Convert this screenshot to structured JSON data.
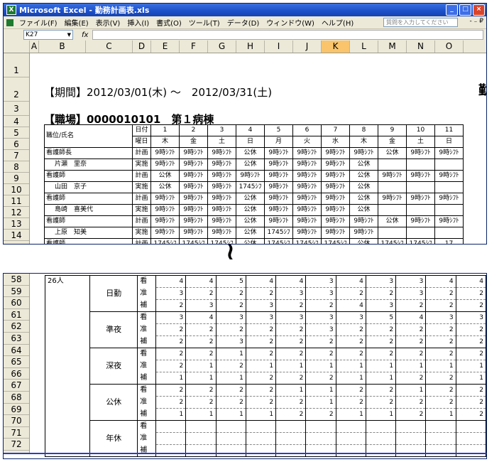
{
  "window": {
    "title": "Microsoft Excel - 勤務計画表.xls",
    "controls": [
      "_",
      "□",
      "×"
    ]
  },
  "menu": {
    "items": [
      "ファイル(F)",
      "編集(E)",
      "表示(V)",
      "挿入(I)",
      "書式(O)",
      "ツール(T)",
      "データ(D)",
      "ウィンドウ(W)",
      "ヘルプ(H)"
    ],
    "help_placeholder": "質問を入力してください",
    "right": "- ₋ ₽"
  },
  "formula": {
    "name_box": "K27",
    "fx": "fx",
    "value": ""
  },
  "columns": [
    "A",
    "B",
    "C",
    "D",
    "E",
    "F",
    "G",
    "H",
    "I",
    "J",
    "K",
    "L",
    "M",
    "N",
    "O"
  ],
  "rows_top": [
    "1",
    "2",
    "3",
    "4",
    "5",
    "6",
    "7",
    "8",
    "9",
    "10",
    "11",
    "12",
    "13",
    "14"
  ],
  "rows_bottom": [
    "58",
    "59",
    "60",
    "61",
    "62",
    "63",
    "64",
    "65",
    "66",
    "67",
    "68",
    "69",
    "70",
    "71",
    "72"
  ],
  "sheet": {
    "period": "【期間】2012/03/01(木) ～　2012/03/31(土)",
    "period_right": "勤",
    "workplace": "【職場】0000010101　第１病棟",
    "header": {
      "job_name": "職位/氏名",
      "date_label": "日付",
      "dow_label": "曜日",
      "dates": [
        "1",
        "2",
        "3",
        "4",
        "5",
        "6",
        "7",
        "8",
        "9",
        "10",
        "11"
      ],
      "dows": [
        "木",
        "金",
        "土",
        "日",
        "月",
        "火",
        "水",
        "木",
        "金",
        "土",
        "日"
      ]
    },
    "staff": [
      {
        "title": "看護師長",
        "name": "片瀬　里奈",
        "plan": [
          "9時ｼﾌﾄ",
          "9時ｼﾌﾄ",
          "9時ｼﾌﾄ",
          "公休",
          "9時ｼﾌﾄ",
          "9時ｼﾌﾄ",
          "9時ｼﾌﾄ",
          "9時ｼﾌﾄ",
          "公休",
          "9時ｼﾌﾄ",
          "9時ｼﾌﾄ"
        ],
        "actual": [
          "9時ｼﾌﾄ",
          "9時ｼﾌﾄ",
          "9時ｼﾌﾄ",
          "公休",
          "9時ｼﾌﾄ",
          "9時ｼﾌﾄ",
          "9時ｼﾌﾄ",
          "公休",
          "",
          "",
          ""
        ]
      },
      {
        "title": "看護師",
        "name": "山田　京子",
        "plan": [
          "公休",
          "9時ｼﾌﾄ",
          "9時ｼﾌﾄ",
          "9時ｼﾌﾄ",
          "9時ｼﾌﾄ",
          "9時ｼﾌﾄ",
          "9時ｼﾌﾄ",
          "公休",
          "9時ｼﾌﾄ",
          "9時ｼﾌﾄ",
          "9時ｼﾌﾄ"
        ],
        "actual": [
          "公休",
          "9時ｼﾌﾄ",
          "9時ｼﾌﾄ",
          "1745ｼﾌ",
          "9時ｼﾌﾄ",
          "9時ｼﾌﾄ",
          "9時ｼﾌﾄ",
          "公休",
          "",
          "",
          ""
        ]
      },
      {
        "title": "看護師",
        "name": "島崎　喜美代",
        "plan": [
          "9時ｼﾌﾄ",
          "9時ｼﾌﾄ",
          "9時ｼﾌﾄ",
          "公休",
          "9時ｼﾌﾄ",
          "9時ｼﾌﾄ",
          "9時ｼﾌﾄ",
          "公休",
          "9時ｼﾌﾄ",
          "9時ｼﾌﾄ",
          "9時ｼﾌﾄ"
        ],
        "actual": [
          "9時ｼﾌﾄ",
          "9時ｼﾌﾄ",
          "9時ｼﾌﾄ",
          "公休",
          "9時ｼﾌﾄ",
          "9時ｼﾌﾄ",
          "9時ｼﾌﾄ",
          "公休",
          "",
          "",
          ""
        ]
      },
      {
        "title": "看護師",
        "name": "上原　知美",
        "plan": [
          "9時ｼﾌﾄ",
          "9時ｼﾌﾄ",
          "9時ｼﾌﾄ",
          "公休",
          "9時ｼﾌﾄ",
          "9時ｼﾌﾄ",
          "9時ｼﾌﾄ",
          "9時ｼﾌﾄ",
          "公休",
          "9時ｼﾌﾄ",
          "9時ｼﾌﾄ"
        ],
        "actual": [
          "9時ｼﾌﾄ",
          "9時ｼﾌﾄ",
          "9時ｼﾌﾄ",
          "公休",
          "1745ｼﾌ",
          "9時ｼﾌﾄ",
          "9時ｼﾌﾄ",
          "9時ｼﾌﾄ",
          "",
          "",
          ""
        ]
      },
      {
        "title": "看護師",
        "name": "",
        "plan": [
          "1745ｼﾌ",
          "1745ｼﾌ",
          "1745ｼﾌ",
          "公休",
          "1745ｼﾌ",
          "1745ｼﾌ",
          "1745ｼﾌ",
          "公休",
          "1745ｼﾌ",
          "1745ｼﾌ",
          "17"
        ],
        "actual": []
      }
    ],
    "plan_label": "計画",
    "actual_label": "実施"
  },
  "summary": {
    "total": "26人",
    "groups": [
      {
        "name": "日勤",
        "rows": [
          {
            "sub": "看",
            "values": [
              "4",
              "4",
              "5",
              "4",
              "4",
              "3",
              "4",
              "3",
              "3",
              "4",
              "4"
            ]
          },
          {
            "sub": "准",
            "values": [
              "3",
              "2",
              "2",
              "2",
              "3",
              "3",
              "2",
              "2",
              "3",
              "2",
              "2"
            ]
          },
          {
            "sub": "補",
            "values": [
              "2",
              "3",
              "2",
              "3",
              "2",
              "2",
              "4",
              "3",
              "2",
              "2",
              "2"
            ]
          }
        ]
      },
      {
        "name": "準夜",
        "rows": [
          {
            "sub": "看",
            "values": [
              "3",
              "4",
              "3",
              "3",
              "3",
              "3",
              "3",
              "5",
              "4",
              "3",
              "3"
            ]
          },
          {
            "sub": "准",
            "values": [
              "2",
              "2",
              "2",
              "2",
              "2",
              "3",
              "2",
              "2",
              "2",
              "2",
              "2"
            ]
          },
          {
            "sub": "補",
            "values": [
              "2",
              "2",
              "3",
              "2",
              "2",
              "2",
              "2",
              "2",
              "2",
              "2",
              "2"
            ]
          }
        ]
      },
      {
        "name": "深夜",
        "rows": [
          {
            "sub": "看",
            "values": [
              "2",
              "2",
              "1",
              "2",
              "2",
              "2",
              "2",
              "2",
              "2",
              "2",
              "2"
            ]
          },
          {
            "sub": "准",
            "values": [
              "2",
              "1",
              "2",
              "1",
              "1",
              "1",
              "1",
              "1",
              "1",
              "1",
              "1"
            ]
          },
          {
            "sub": "補",
            "values": [
              "1",
              "1",
              "1",
              "2",
              "2",
              "2",
              "1",
              "1",
              "2",
              "2",
              "1"
            ]
          }
        ]
      },
      {
        "name": "公休",
        "rows": [
          {
            "sub": "看",
            "values": [
              "2",
              "2",
              "2",
              "2",
              "1",
              "1",
              "2",
              "2",
              "1",
              "2",
              "2"
            ]
          },
          {
            "sub": "准",
            "values": [
              "2",
              "2",
              "2",
              "2",
              "2",
              "1",
              "2",
              "2",
              "2",
              "2",
              "2"
            ]
          },
          {
            "sub": "補",
            "values": [
              "1",
              "1",
              "1",
              "1",
              "2",
              "2",
              "1",
              "1",
              "2",
              "1",
              "2"
            ]
          }
        ]
      },
      {
        "name": "年休",
        "rows": [
          {
            "sub": "看",
            "values": [
              "",
              "",
              "",
              "",
              "",
              "",
              "",
              "",
              "",
              "",
              ""
            ]
          },
          {
            "sub": "准",
            "values": [
              "",
              "",
              "",
              "",
              "",
              "",
              "",
              "",
              "",
              "",
              ""
            ]
          },
          {
            "sub": "補",
            "values": [
              "",
              "",
              "",
              "",
              "",
              "",
              "",
              "",
              "",
              "",
              ""
            ]
          }
        ]
      }
    ]
  },
  "separator": "≀"
}
